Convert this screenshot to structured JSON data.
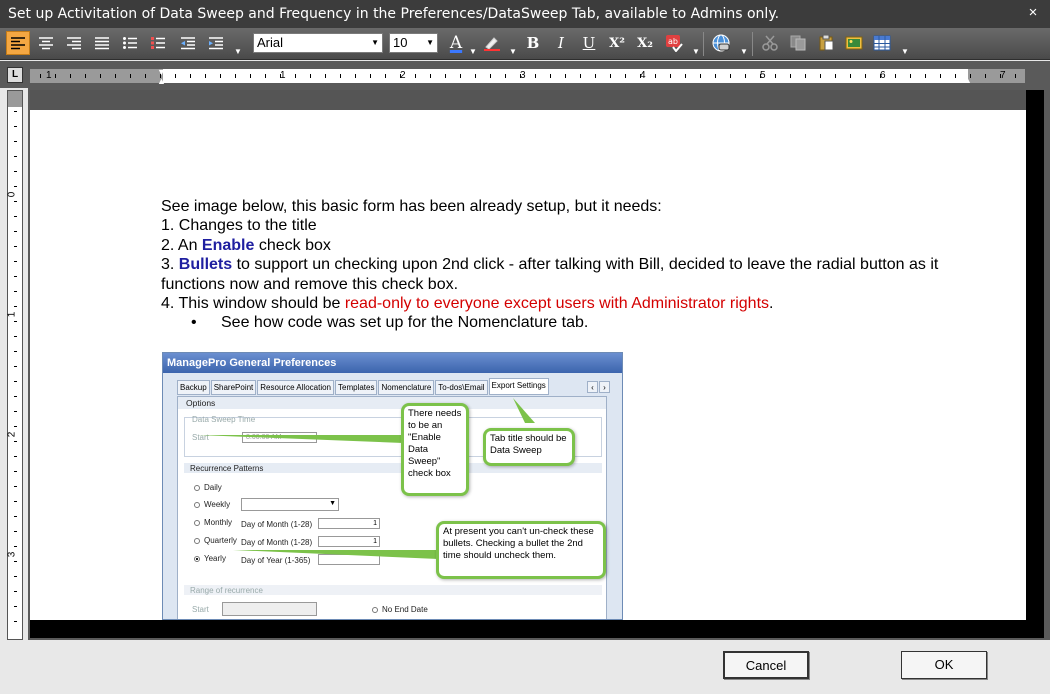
{
  "window": {
    "title": "Set up Activitation of Data Sweep and Frequency in the Preferences/DataSweep Tab, available to Admins only.",
    "close_label": "×"
  },
  "toolbar": {
    "font_name": "Arial",
    "font_size": "10",
    "bold_label": "B",
    "italic_label": "I",
    "underline_label": "U",
    "superscript_label": "X²",
    "subscript_label": "X₂",
    "font_color_label": "A",
    "accent_color": "#f4a742"
  },
  "ruler": {
    "corner_label": "L",
    "h_numbers": [
      "1",
      "1",
      "2",
      "3",
      "4",
      "5",
      "6",
      "7"
    ],
    "v_numbers": [
      "0",
      "1",
      "2",
      "3"
    ]
  },
  "document": {
    "intro": "See image below, this basic form has been already setup, but it needs:",
    "item1": "1. Changes to the title",
    "item2_pre": "2. An ",
    "item2_em": "Enable",
    "item2_post": " check box",
    "item3_pre": "3. ",
    "item3_em": "Bullets",
    "item3_post": " to support un checking upon 2nd click - after talking with Bill, decided to leave the radial button as it functions now and remove this check box.",
    "item4_pre": "4. This window should be ",
    "item4_red": "read-only to everyone except users with Administrator rights",
    "item4_post": ".",
    "bullet_mark": "•",
    "bullet_text": "See how code was set up for the Nomenclature tab."
  },
  "embedded_screenshot": {
    "title": "ManagePro General Preferences",
    "tabs": [
      "Backup",
      "SharePoint",
      "Resource Allocation",
      "Templates",
      "Nomenclature",
      "To-dos\\Email",
      "Export Settings"
    ],
    "options_label": "Options",
    "data_sweep_time": "Data Sweep Time",
    "start_label": "Start",
    "start_value": "8:00:00 AM",
    "recurrence_patterns": "Recurrence Patterns",
    "daily": "Daily",
    "weekly": "Weekly",
    "monthly": "Monthly",
    "quarterly": "Quarterly",
    "yearly": "Yearly",
    "day_of_month_1": "Day of Month (1-28)",
    "day_of_month_2": "Day of Month (1-28)",
    "day_of_year": "Day of Year (1-365)",
    "monthly_value": "1",
    "quarterly_value": "1",
    "range_of_recurrence": "Range of recurrence",
    "range_start": "Start",
    "no_end_date": "No End Date",
    "callout_enable": "There needs to be an \"Enable Data Sweep\" check box",
    "callout_tab": "Tab title should be Data Sweep",
    "callout_bullets": "At present you can't un-check these bullets. Checking a bullet the 2nd time should uncheck them."
  },
  "footer": {
    "cancel_label": "Cancel",
    "ok_label": "OK"
  }
}
